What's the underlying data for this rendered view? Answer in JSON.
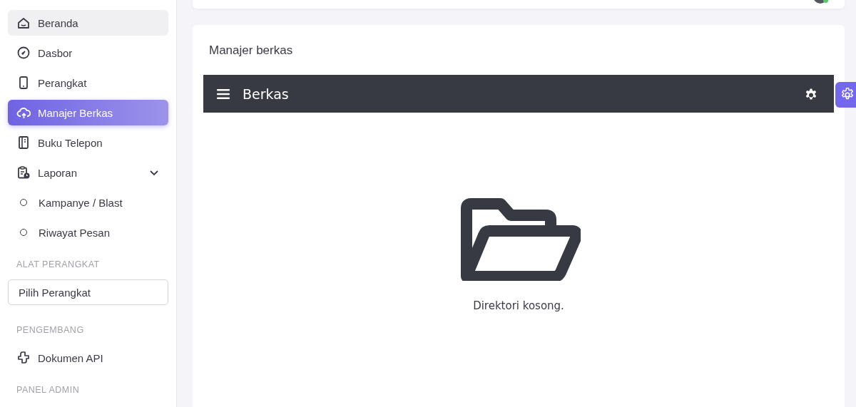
{
  "sidebar": {
    "items": [
      {
        "kind": "link",
        "label": "Beranda",
        "selected": false,
        "hovered": true
      },
      {
        "kind": "link",
        "label": "Dasbor",
        "selected": false,
        "hovered": false
      },
      {
        "kind": "link",
        "label": "Perangkat",
        "selected": false,
        "hovered": false
      },
      {
        "kind": "link",
        "label": "Manajer Berkas",
        "selected": true,
        "hovered": false
      },
      {
        "kind": "link",
        "label": "Buku Telepon",
        "selected": false,
        "hovered": false
      },
      {
        "kind": "group",
        "label": "Laporan",
        "expanded": true
      },
      {
        "kind": "sub",
        "label": "Kampanye / Blast"
      },
      {
        "kind": "sub",
        "label": "Riwayat Pesan"
      },
      {
        "kind": "section",
        "label": "ALAT PERANGKAT"
      },
      {
        "kind": "select",
        "placeholder": "Pilih Perangkat"
      },
      {
        "kind": "section",
        "label": "PENGEMBANG"
      },
      {
        "kind": "link",
        "label": "Dokumen API",
        "selected": false,
        "hovered": false
      },
      {
        "kind": "section",
        "label": "PANEL ADMIN"
      }
    ]
  },
  "user": {
    "online": true
  },
  "card": {
    "title": "Manajer berkas",
    "toolbar": {
      "title": "Berkas"
    },
    "empty_message": "Direktori kosong."
  }
}
